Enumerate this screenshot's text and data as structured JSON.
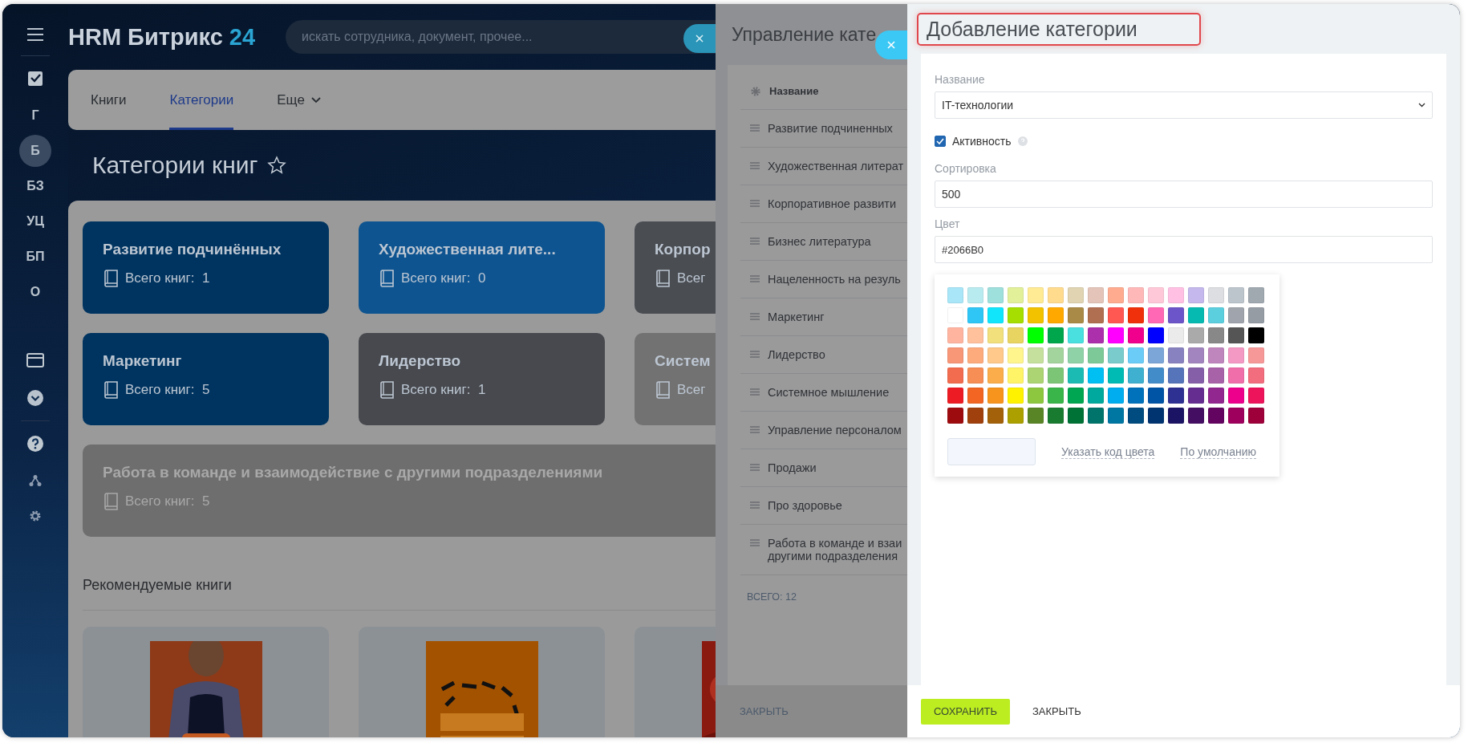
{
  "sidebar": {
    "items": [
      {
        "label": "Г",
        "selected": false
      },
      {
        "label": "Б",
        "selected": true
      },
      {
        "label": "БЗ",
        "selected": false
      },
      {
        "label": "УЦ",
        "selected": false
      },
      {
        "label": "БП",
        "selected": false
      },
      {
        "label": "О",
        "selected": false
      }
    ]
  },
  "header": {
    "logo": "HRM Битрикс",
    "logo_number": "24",
    "search": {
      "placeholder": "искать сотрудника, документ, прочее..."
    }
  },
  "tabs": [
    {
      "label": "Книги",
      "selected": false,
      "kind": "link"
    },
    {
      "label": "Категории",
      "selected": true,
      "kind": "link"
    },
    {
      "label": "Еще",
      "selected": false,
      "kind": "menu"
    }
  ],
  "page_title": "Категории книг",
  "categories": [
    {
      "title": "Развитие подчинённых",
      "count_label": "Всего книг:",
      "count": "1",
      "color": "#003460",
      "wide": false
    },
    {
      "title": "Художественная лите...",
      "count_label": "Всего книг:",
      "count": "0",
      "color": "#0e5490",
      "wide": false
    },
    {
      "title": "Корпор",
      "count_label": "Всег",
      "color": "#4a4d52",
      "wide": false
    },
    {
      "title": "Маркетинг",
      "count_label": "Всего книг:",
      "count": "5",
      "color": "#003460",
      "wide": false
    },
    {
      "title": "Лидерство",
      "count_label": "Всего книг:",
      "count": "1",
      "color": "#47494e",
      "wide": false
    },
    {
      "title": "Систем",
      "count_label": "Всег",
      "color": "#727272",
      "wide": false
    },
    {
      "title": "Работа в команде и взаимодействие с другими подразделениями",
      "count_label": "Всего книг:",
      "count": "5",
      "color": "#6e6e6e",
      "wide": true
    }
  ],
  "recommended": {
    "title": "Рекомендуемые книги"
  },
  "category_panel": {
    "title": "Управление кате",
    "column": "Название",
    "items": [
      "Развитие подчиненных",
      "Художественная литерат",
      "Корпоративное развити",
      "Бизнес литература",
      "Нацеленность на резуль",
      "Маркетинг",
      "Лидерство",
      "Системное мышление",
      "Управление персоналом",
      "Продажи",
      "Про здоровье",
      "Работа в команде и взаи\nдругими подразделения"
    ],
    "total": "ВСЕГО: 12",
    "close": "ЗАКРЫТЬ"
  },
  "form": {
    "title": "Добавление категории",
    "name_label": "Название",
    "name_value": "IT-технологии",
    "active": {
      "label": "Активность",
      "checked": true
    },
    "sort_label": "Сортировка",
    "sort_value": "500",
    "color_label": "Цвет",
    "color_value": "#2066B0",
    "palette": [
      [
        {
          "color": "#a8e6f8"
        },
        {
          "color": "#b8ebf0"
        },
        {
          "color": "#9ee0dc"
        },
        {
          "color": "#e2f09a"
        },
        {
          "color": "#ffeb94"
        },
        {
          "color": "#ffdb8e"
        },
        {
          "color": "#e0d4b2"
        },
        {
          "color": "#e4c4b8"
        },
        {
          "color": "#ffab90"
        },
        {
          "color": "#ffb8b8"
        },
        {
          "color": "#ffc8d8"
        },
        {
          "color": "#ffc0e4"
        },
        {
          "color": "#c4b8ec"
        },
        {
          "color": "#dcdee2"
        },
        {
          "color": "#bcc4cc"
        },
        {
          "color": "#a0a8b0"
        }
      ],
      [
        {
          "color": "#ffffff"
        },
        {
          "color": "#2fc6f6"
        },
        {
          "color": "#10e5fc"
        },
        {
          "color": "#a5de00"
        },
        {
          "color": "#f2c200"
        },
        {
          "color": "#ffa900"
        },
        {
          "color": "#a98a47"
        },
        {
          "color": "#b06f50"
        },
        {
          "color": "#ff5752"
        },
        {
          "color": "#f0300a"
        },
        {
          "color": "#ff68b4"
        },
        {
          "color": "#6c55c8"
        },
        {
          "color": "#06bab1"
        },
        {
          "color": "#5ccfdf"
        },
        {
          "color": "#a0a4ac"
        },
        {
          "color": "#959ca4"
        }
      ],
      [
        {
          "color": "#ffb4a0"
        },
        {
          "color": "#ffc09c"
        },
        {
          "color": "#f2e07c"
        },
        {
          "color": "#e8d460"
        },
        {
          "color": "#00ff00"
        },
        {
          "color": "#00a64c"
        },
        {
          "color": "#4ae0e0"
        },
        {
          "color": "#ac2fac"
        },
        {
          "color": "#ff00ff"
        },
        {
          "color": "#f0008c"
        },
        {
          "color": "#0000ff"
        },
        {
          "color": "#ebebeb"
        },
        {
          "color": "#aaaaaa"
        },
        {
          "color": "#888888"
        },
        {
          "color": "#555555"
        },
        {
          "color": "#000000"
        }
      ],
      [
        {
          "color": "#f89678"
        },
        {
          "color": "#fdab7d"
        },
        {
          "color": "#fec98a"
        },
        {
          "color": "#fff58c"
        },
        {
          "color": "#c5e09c"
        },
        {
          "color": "#a4d49d"
        },
        {
          "color": "#8fd2a8"
        },
        {
          "color": "#7dca98"
        },
        {
          "color": "#7acbcb"
        },
        {
          "color": "#6bcdf7"
        },
        {
          "color": "#7ca6d8"
        },
        {
          "color": "#8882c0"
        },
        {
          "color": "#a285be"
        },
        {
          "color": "#bf86bd"
        },
        {
          "color": "#f498c4"
        },
        {
          "color": "#f79898"
        }
      ],
      [
        {
          "color": "#f26c4f"
        },
        {
          "color": "#f68e55"
        },
        {
          "color": "#fbad4b"
        },
        {
          "color": "#fff467"
        },
        {
          "color": "#acd472"
        },
        {
          "color": "#7cc576"
        },
        {
          "color": "#1bbbb4"
        },
        {
          "color": "#00bff3"
        },
        {
          "color": "#00bbb4"
        },
        {
          "color": "#3fb0cf"
        },
        {
          "color": "#438cca"
        },
        {
          "color": "#5574b9"
        },
        {
          "color": "#8560a8"
        },
        {
          "color": "#a862a8"
        },
        {
          "color": "#f06ea9"
        },
        {
          "color": "#f26d7d"
        }
      ],
      [
        {
          "color": "#ed1c24"
        },
        {
          "color": "#f26522"
        },
        {
          "color": "#f7941d"
        },
        {
          "color": "#fff200"
        },
        {
          "color": "#8dc73f"
        },
        {
          "color": "#39b54a"
        },
        {
          "color": "#00a651"
        },
        {
          "color": "#00a99d"
        },
        {
          "color": "#00aeef"
        },
        {
          "color": "#0072bc"
        },
        {
          "color": "#0054a6"
        },
        {
          "color": "#2e3192"
        },
        {
          "color": "#662d91"
        },
        {
          "color": "#92278f"
        },
        {
          "color": "#ec008c"
        },
        {
          "color": "#ed145b"
        }
      ],
      [
        {
          "color": "#9e0b0f"
        },
        {
          "color": "#a0410d"
        },
        {
          "color": "#a3620a"
        },
        {
          "color": "#aba000"
        },
        {
          "color": "#598527"
        },
        {
          "color": "#197b30"
        },
        {
          "color": "#007236"
        },
        {
          "color": "#00746b"
        },
        {
          "color": "#0076a3"
        },
        {
          "color": "#004b80"
        },
        {
          "color": "#003471"
        },
        {
          "color": "#1b1464"
        },
        {
          "color": "#440e62"
        },
        {
          "color": "#630460"
        },
        {
          "color": "#9e005d"
        },
        {
          "color": "#9e0039"
        }
      ]
    ],
    "custom_code": "Указать код цвета",
    "default": "По умолчанию",
    "save": "СОХРАНИТЬ",
    "close": "ЗАКРЫТЬ"
  }
}
